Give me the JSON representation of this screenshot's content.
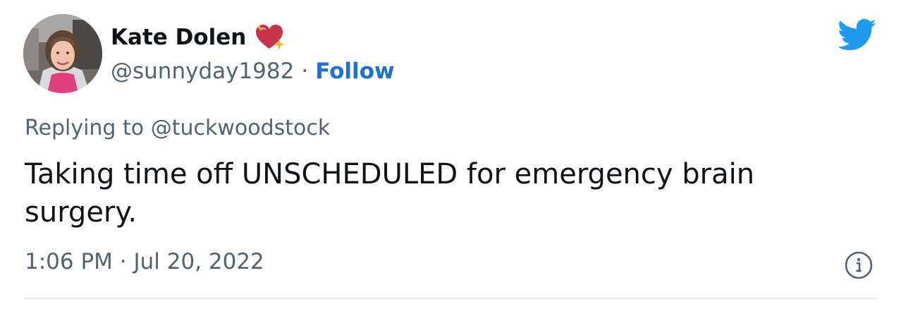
{
  "author": {
    "display_name": "Kate Dolen",
    "handle": "@sunnyday1982",
    "separator": "·",
    "follow_label": "Follow",
    "badge_icon": "sparkling-heart-icon",
    "avatar": "profile-photo-avatar"
  },
  "platform_icon": "twitter-bird-icon",
  "reply": {
    "prefix": "Replying to",
    "mention": "@tuckwoodstock"
  },
  "tweet": {
    "text": "Taking time off UNSCHEDULED for emergency brain surgery.",
    "timestamp": "1:06 PM · Jul 20, 2022"
  },
  "info_icon": "info-circle-icon",
  "colors": {
    "follow": "#1d72d6",
    "twitter_blue": "#1d9bf0",
    "secondary_text": "#536471",
    "primary_text": "#0f1419",
    "heart": "#c8324a",
    "divider": "#e3e7ea"
  }
}
